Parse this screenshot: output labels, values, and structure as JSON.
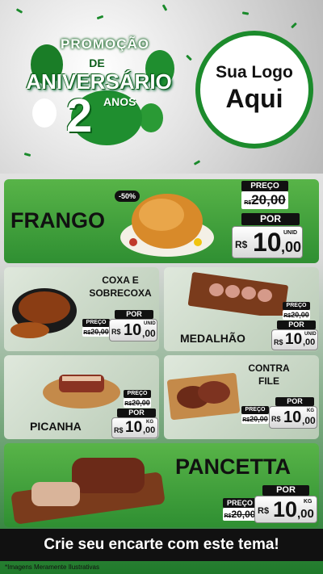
{
  "header": {
    "promo_line1": "PROMOÇÃO",
    "promo_line2": "DE",
    "promo_line3": "ANIVERSÁRIO",
    "promo_number": "2",
    "promo_anos": "ANOS",
    "logo_line1": "Sua Logo",
    "logo_line2": "Aqui"
  },
  "products": {
    "frango": {
      "name": "FRANGO",
      "discount": "-50%",
      "preco_label": "PREÇO",
      "old_currency": "R$",
      "old_value": "20,00",
      "por_label": "POR",
      "new_currency": "R$",
      "new_int": "10",
      "new_dec": ",00",
      "unit": "UNID"
    },
    "coxa": {
      "name_line1": "COXA E",
      "name_line2": "SOBRECOXA",
      "preco_label": "PREÇO",
      "old_currency": "R$",
      "old_value": "20,00",
      "por_label": "POR",
      "new_currency": "R$",
      "new_int": "10",
      "new_dec": ",00",
      "unit": "UNID"
    },
    "medalhao": {
      "name": "MEDALHÃO",
      "preco_label": "PREÇO",
      "old_currency": "R$",
      "old_value": "20,00",
      "por_label": "POR",
      "new_currency": "R$",
      "new_int": "10",
      "new_dec": ",00",
      "unit": "UNID"
    },
    "picanha": {
      "name": "PICANHA",
      "preco_label": "PREÇO",
      "old_currency": "R$",
      "old_value": "20,00",
      "por_label": "POR",
      "new_currency": "R$",
      "new_int": "10",
      "new_dec": ",00",
      "unit": "KG"
    },
    "contrafile": {
      "name_line1": "CONTRA",
      "name_line2": "FILE",
      "preco_label": "PREÇO",
      "old_currency": "R$",
      "old_value": "20,00",
      "por_label": "POR",
      "new_currency": "R$",
      "new_int": "10",
      "new_dec": ",00",
      "unit": "KG"
    },
    "pancetta": {
      "name": "PANCETTA",
      "preco_label": "PREÇO",
      "old_currency": "R$",
      "old_value": "20,00",
      "por_label": "POR",
      "new_currency": "R$",
      "new_int": "10",
      "new_dec": ",00",
      "unit": "KG"
    }
  },
  "footer": {
    "cta": "Crie seu encarte com este tema!",
    "disclaimer": "*Imagens Meramente Ilustrativas"
  },
  "colors": {
    "brand_green": "#1c8b2c",
    "dark": "#111111"
  }
}
